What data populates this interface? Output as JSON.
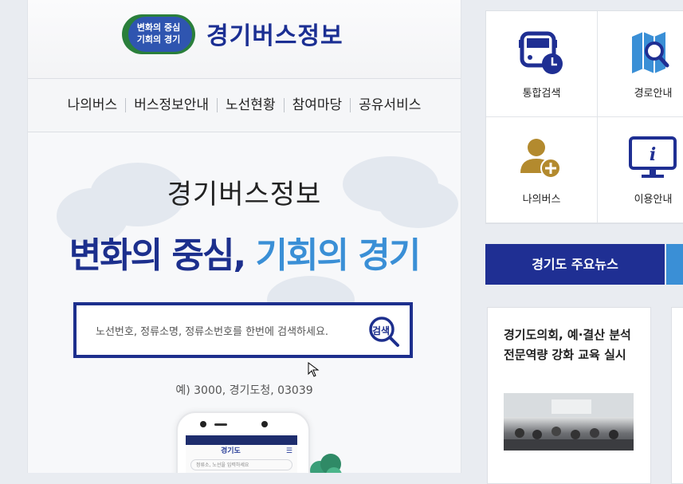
{
  "header": {
    "logo_badge_line1": "변화의 중심",
    "logo_badge_line2": "기회의 경기",
    "logo_title": "경기버스정보"
  },
  "nav": {
    "items": [
      "나의버스",
      "버스정보안내",
      "노선현황",
      "참여마당",
      "공유서비스"
    ]
  },
  "hero": {
    "subtitle": "경기버스정보",
    "title_part1": "변화의 중심,",
    "title_part2": "기회의 경기"
  },
  "search": {
    "placeholder": "노선번호, 정류소명, 정류소번호를 한번에 검색하세요.",
    "button_label": "검색",
    "example": "예) 3000, 경기도청, 03039"
  },
  "phone": {
    "brand": "경기도",
    "placeholder": "정류소, 노선을 입력하세요"
  },
  "quick_menu": {
    "items": [
      {
        "label": "통합검색",
        "icon": "bus-clock-icon"
      },
      {
        "label": "경로안내",
        "icon": "map-search-icon"
      },
      {
        "label": "나의버스",
        "icon": "user-add-icon"
      },
      {
        "label": "이용안내",
        "icon": "monitor-info-icon"
      }
    ]
  },
  "news": {
    "tab_active": "경기도 주요뉴스",
    "card_title": "경기도의회, 예·결산 분석 전문역량 강화 교육 실시"
  },
  "colors": {
    "primary": "#1f2f93",
    "accent": "#3a8fd6",
    "gold": "#b38a2e"
  }
}
